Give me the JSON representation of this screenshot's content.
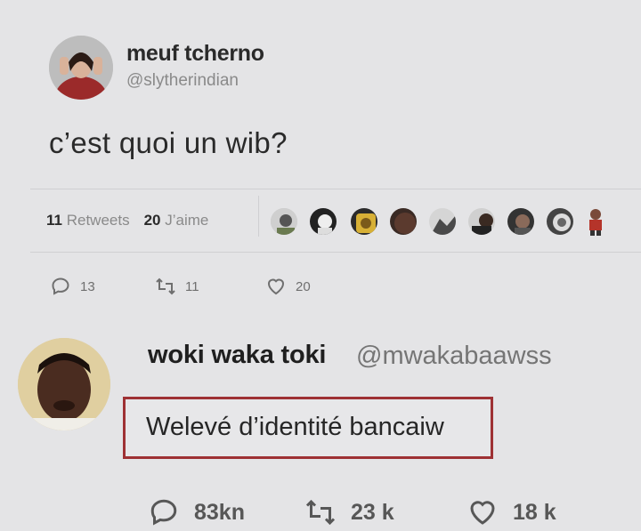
{
  "tweet": {
    "author_name": "meuf tcherno",
    "author_handle": "@slytherindian",
    "text": "c’est quoi un wib?",
    "stats": {
      "retweets_count": "11",
      "retweets_label": "Retweets",
      "likes_count": "20",
      "likes_label": "J’aime"
    },
    "actions": {
      "reply_count": "13",
      "retweet_count": "11",
      "like_count": "20"
    }
  },
  "reply": {
    "author_name": "woki waka toki",
    "author_handle": "@mwakabaawss",
    "text": "Welevé d’identité bancaiw",
    "highlight_color": "#9e3134",
    "actions": {
      "reply_count": "83kn",
      "retweet_count": "23 k",
      "like_count": "18 k"
    }
  },
  "icons": [
    "reply-icon",
    "retweet-icon",
    "like-icon"
  ]
}
